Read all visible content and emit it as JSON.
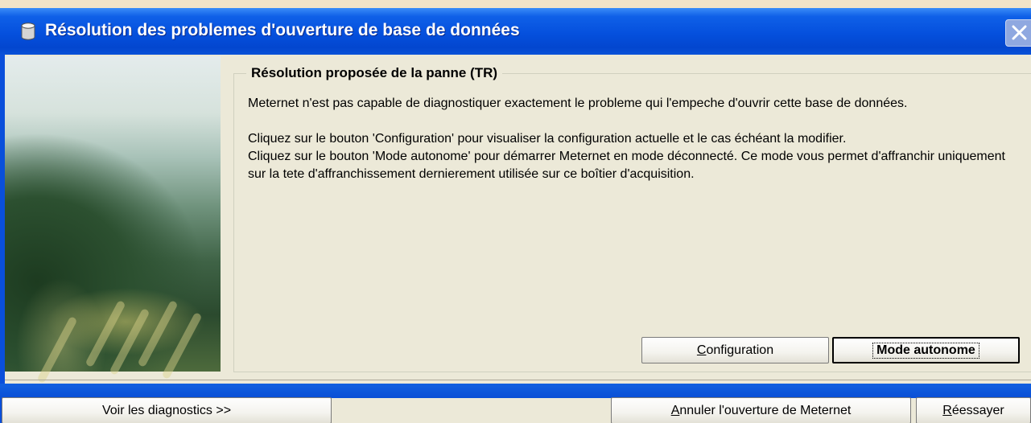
{
  "window": {
    "title": "Résolution des problemes d'ouverture de base de données",
    "icon": "database-icon"
  },
  "panel": {
    "legend": "Résolution proposée de la panne (TR)",
    "paragraphs": [
      "Meternet n'est pas capable de diagnostiquer exactement le probleme qui l'empeche d'ouvrir cette base de données.",
      "Cliquez sur le bouton 'Configuration' pour visualiser la configuration actuelle et le cas échéant la modifier.",
      "Cliquez sur le bouton 'Mode autonome' pour démarrer Meternet en mode déconnecté. Ce mode vous permet d'affranchir uniquement sur la tete d'affranchissement dernierement utilisée sur ce boîtier d'acquisition."
    ]
  },
  "buttons": {
    "configuration": {
      "mnemonic": "C",
      "rest": "onfiguration"
    },
    "mode_autonome": "Mode autonome",
    "voir_diagnostics": "Voir les diagnostics >>",
    "annuler": {
      "mnemonic": "A",
      "rest": "nnuler l'ouverture de Meternet"
    },
    "reessayer": {
      "mnemonic": "R",
      "rest": "éessayer"
    }
  },
  "colors": {
    "titlebar": "#0550dd",
    "face": "#ece9d8",
    "band": "#0a4fd6"
  }
}
